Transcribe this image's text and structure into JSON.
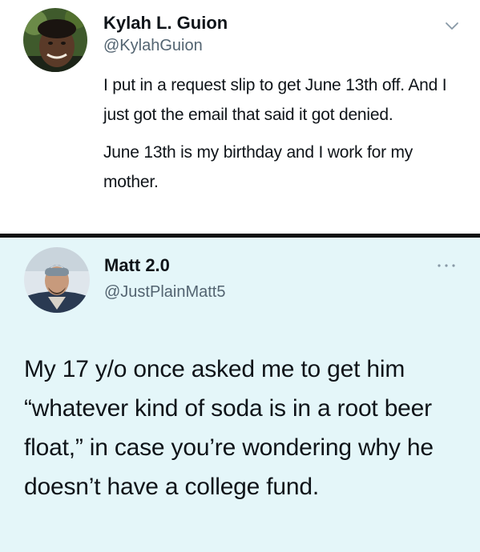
{
  "tweets": [
    {
      "display_name": "Kylah L. Guion",
      "handle": "@KylahGuion",
      "paragraphs": [
        "I put in a request slip to get June 13th off. And I just got the email that said it got denied.",
        "June 13th is my birthday and I work for my mother."
      ],
      "menu_icon": "chevron-down-icon"
    },
    {
      "display_name": "Matt 2.0",
      "handle": "@JustPlainMatt5",
      "text": "My 17 y/o once asked me to get him “whatever kind of soda is in a root beer float,” in case you’re wondering why he doesn’t have a college fund.",
      "menu_icon": "more-options-icon"
    }
  ],
  "colors": {
    "tweet1_background": "#ffffff",
    "tweet2_background": "#e4f6f9",
    "divider": "#111111",
    "handle_text": "#536471",
    "icon": "#8899a6"
  }
}
